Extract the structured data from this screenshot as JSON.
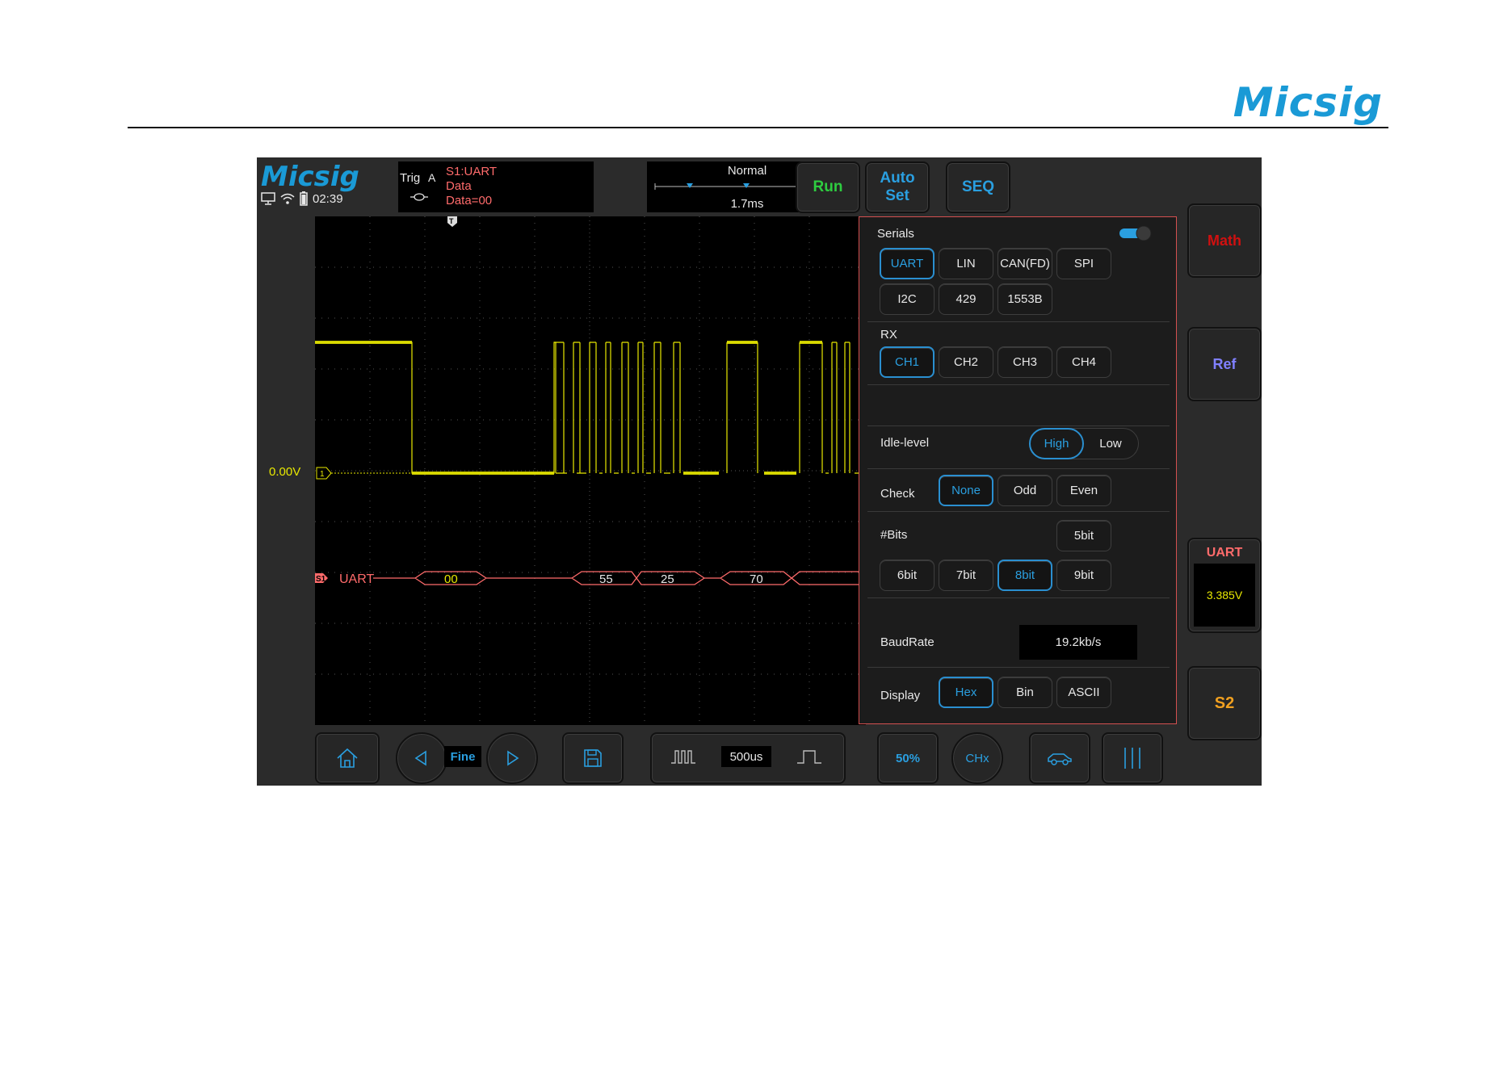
{
  "page": {
    "brand": "Micsig"
  },
  "screen": {
    "logo": "Micsig",
    "clock": "02:39",
    "trigger": {
      "label": "Trig",
      "source": "A",
      "line1": "S1:UART",
      "line2": "Data",
      "line3": "Data=00"
    },
    "horizontal": {
      "mode": "Normal",
      "position": "1.7ms"
    },
    "top_buttons": {
      "run": "Run",
      "auto_line1": "Auto",
      "auto_line2": "Set",
      "seq": "SEQ"
    },
    "channel_offset": "0.00V",
    "ch1_marker": "1",
    "trigger_marker": "T",
    "serial_badge": "S1",
    "bus_label": "UART",
    "decoded_bytes": [
      "00",
      "55",
      "25",
      "70"
    ],
    "colors": {
      "ch1": "#e8e800",
      "bus": "#ff6b6b",
      "accent": "#2a9fe0",
      "run": "#2ecc40",
      "math": "#d01010",
      "ref": "#8080ff",
      "s2": "#f0a020"
    }
  },
  "panel": {
    "serials_label": "Serials",
    "serials_enabled": true,
    "protocols_row1": [
      "UART",
      "LIN",
      "CAN(FD)",
      "SPI"
    ],
    "protocols_row2": [
      "I2C",
      "429",
      "1553B"
    ],
    "selected_protocol": "UART",
    "rx_label": "RX",
    "rx_channels": [
      "CH1",
      "CH2",
      "CH3",
      "CH4"
    ],
    "selected_rx": "CH1",
    "idle_label": "Idle-level",
    "idle_high": "High",
    "idle_low": "Low",
    "selected_idle": "High",
    "check_label": "Check",
    "check_options": [
      "None",
      "Odd",
      "Even"
    ],
    "selected_check": "None",
    "bits_label": "#Bits",
    "bits_top": "5bit",
    "bits_row": [
      "6bit",
      "7bit",
      "8bit",
      "9bit"
    ],
    "selected_bits": "8bit",
    "baud_label": "BaudRate",
    "baud_value": "19.2kb/s",
    "display_label": "Display",
    "display_options": [
      "Hex",
      "Bin",
      "ASCII"
    ],
    "selected_display": "Hex"
  },
  "right_column": {
    "math": "Math",
    "ref": "Ref",
    "uart_title": "UART",
    "uart_value": "3.385V",
    "s2": "S2"
  },
  "bottom_bar": {
    "fine": "Fine",
    "timebase": "500us",
    "percent": "50%",
    "chx": "CHx"
  }
}
